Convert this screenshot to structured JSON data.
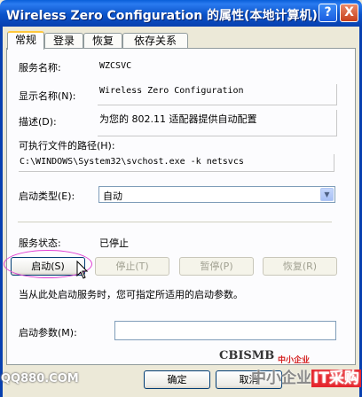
{
  "window": {
    "title": "Wireless Zero Configuration 的属性(本地计算机)",
    "help": "?",
    "close": "X"
  },
  "tabs": [
    "常规",
    "登录",
    "恢复",
    "依存关系"
  ],
  "general": {
    "service_name_label": "服务名称:",
    "service_name_value": "WZCSVC",
    "display_name_label": "显示名称(N):",
    "display_name_value": "Wireless Zero Configuration",
    "description_label": "描述(D):",
    "description_value": "为您的 802.11 适配器提供自动配置",
    "path_label": "可执行文件的路径(H):",
    "path_value": "C:\\WINDOWS\\System32\\svchost.exe -k netsvcs",
    "startup_type_label": "启动类型(E):",
    "startup_type_value": "自动",
    "status_label": "服务状态:",
    "status_value": "已停止",
    "start_button": "启动(S)",
    "stop_button": "停止(T)",
    "pause_button": "暂停(P)",
    "resume_button": "恢复(R)",
    "hint": "当从此处启动服务时，您可指定所适用的启动参数。",
    "params_label": "启动参数(M):",
    "params_value": ""
  },
  "footer": {
    "ok": "确定",
    "cancel": "取消"
  },
  "watermarks": {
    "left": "QQ880.COM",
    "logo": "CBISMB",
    "logo_sub": "中小企业",
    "right_a": "中小企业",
    "right_b": "IT采购"
  }
}
